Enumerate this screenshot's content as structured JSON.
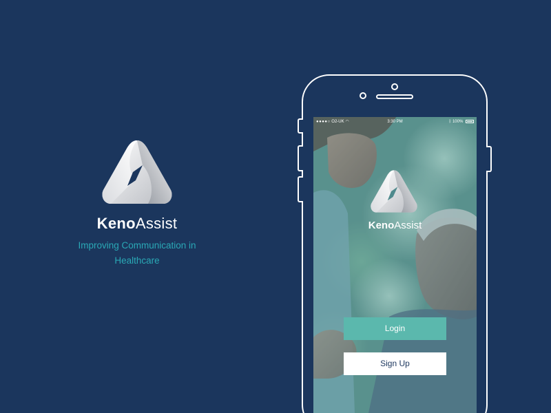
{
  "brand": {
    "name_bold": "Keno",
    "name_light": "Assist",
    "tagline_line1": "Improving Communication in",
    "tagline_line2": "Healthcare",
    "logo_icon": "triangle-ribbon-logo-icon"
  },
  "phone": {
    "status_bar": {
      "carrier": "O2-UK",
      "time": "3:30 PM",
      "battery": "100%"
    },
    "screen": {
      "brand_bold": "Keno",
      "brand_light": "Assist",
      "login_label": "Login",
      "signup_label": "Sign Up"
    }
  },
  "colors": {
    "background": "#1b365d",
    "tagline": "#2aa9b6",
    "login_button": "#5bb8ad",
    "signup_button": "#ffffff"
  }
}
